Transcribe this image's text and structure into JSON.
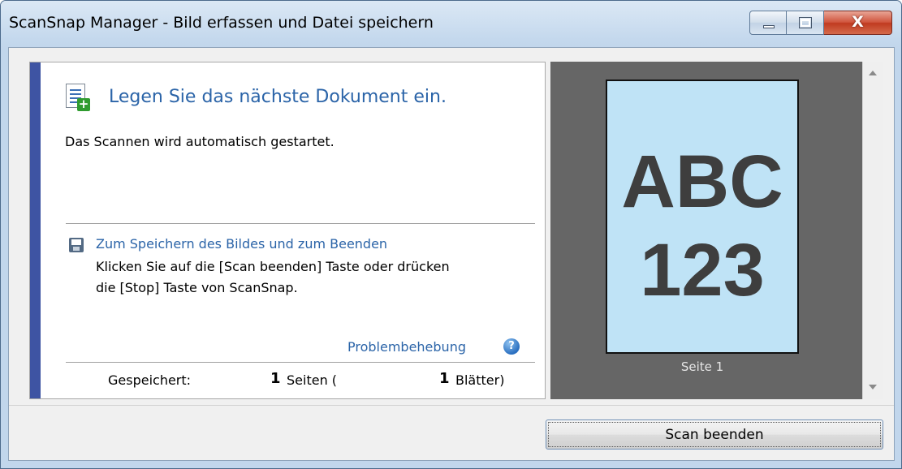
{
  "window": {
    "title": "ScanSnap Manager - Bild erfassen und Datei speichern",
    "buttons": {
      "minimize": "minimize",
      "maximize": "maximize",
      "close_glyph": "X"
    }
  },
  "panel": {
    "heading": "Legen Sie das nächste Dokument ein.",
    "subtext": "Das Scannen wird automatisch gestartet.",
    "save": {
      "title": "Zum Speichern des Bildes und zum Beenden",
      "line1": "Klicken Sie auf die [Scan beenden] Taste oder drücken",
      "line2": "die [Stop] Taste von ScanSnap."
    },
    "troubleshooting": "Problembehebung",
    "help_glyph": "?",
    "status": {
      "saved_label": "Gespeichert:",
      "pages_count": "1",
      "pages_unit": "Seiten (",
      "sheets_count": "1",
      "sheets_unit": "Blätter)"
    }
  },
  "preview": {
    "page_text_line1": "ABC",
    "page_text_line2": "123",
    "page_caption": "Seite 1",
    "background_color": "#666666",
    "page_color": "#bfe3f6"
  },
  "footer": {
    "scan_end_label": "Scan beenden"
  },
  "colors": {
    "accent": "#3e54a3",
    "link": "#2b64a8",
    "close_button": "#c03a20"
  },
  "icons": {
    "document": "document-add-icon",
    "save": "floppy-disk-icon",
    "help": "help-icon"
  }
}
